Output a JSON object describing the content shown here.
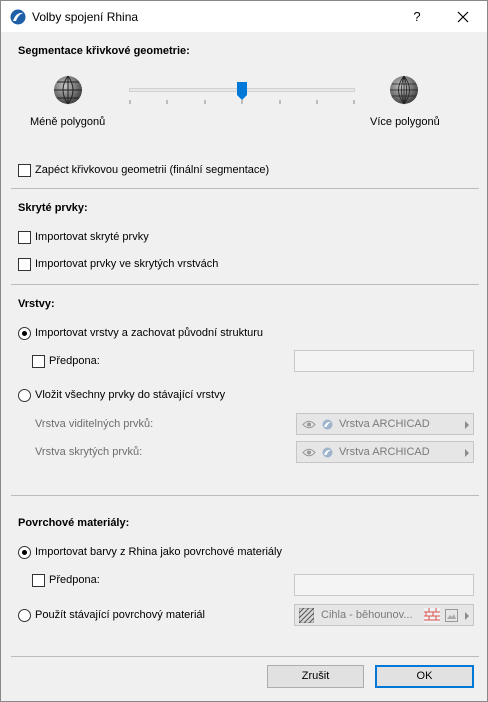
{
  "window": {
    "title": "Volby spojení Rhina",
    "help_label": "?"
  },
  "segmentation": {
    "heading": "Segmentace křivkové geometrie:",
    "slider_level": 0.5,
    "less_label": "Méně polygonů",
    "more_label": "Více polygonů",
    "bake_label": "Zapéct křivkovou geometrii (finální segmentace)",
    "bake_checked": false
  },
  "hidden": {
    "heading": "Skryté prvky:",
    "import_hidden_label": "Importovat skryté prvky",
    "import_hidden_checked": false,
    "import_hidden_layers_label": "Importovat prvky ve skrytých vrstvách",
    "import_hidden_layers_checked": false
  },
  "layers": {
    "heading": "Vrstvy:",
    "keep_structure_label": "Importovat vrstvy a zachovat původní strukturu",
    "keep_structure_selected": true,
    "prefix_label": "Předpona:",
    "prefix_value": "",
    "single_layer_label": "Vložit všechny prvky do stávající vrstvy",
    "single_layer_selected": false,
    "visible_layer_label": "Vrstva viditelných prvků:",
    "visible_layer_value": "Vrstva ARCHICAD",
    "hidden_layer_label": "Vrstva skrytých prvků:",
    "hidden_layer_value": "Vrstva ARCHICAD"
  },
  "materials": {
    "heading": "Povrchové materiály:",
    "import_colors_label": "Importovat barvy z Rhina jako povrchové materiály",
    "import_colors_selected": true,
    "prefix_label": "Předpona:",
    "prefix_value": "",
    "use_existing_label": "Použít stávající povrchový materiál",
    "use_existing_selected": false,
    "material_value": "Cihla - běhounov..."
  },
  "buttons": {
    "cancel_label": "Zrušit",
    "ok_label": "OK"
  },
  "colors": {
    "accent": "#0078d7",
    "separator": "#bcbcbc",
    "disabled_text": "#6d6d6d"
  }
}
